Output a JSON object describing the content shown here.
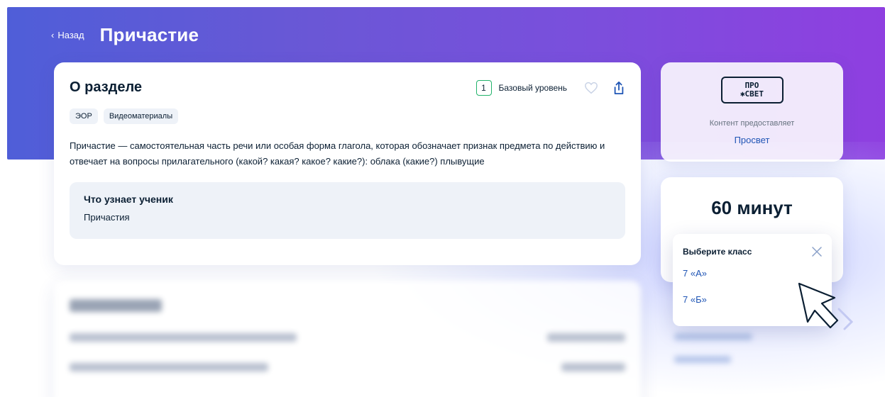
{
  "header": {
    "back_label": "Назад",
    "title": "Причастие"
  },
  "about": {
    "title": "О разделе",
    "level_number": "1",
    "level_label": "Базовый уровень",
    "tags": [
      "ЭОР",
      "Видеоматериалы"
    ],
    "description": "Причастие — самостоятельная часть речи или особая форма глагола, которая обозначает признак предмета по действию и отвечает на вопросы прилагательного (какой? какая? какое? какие?): облака (какие?) плывущие",
    "learn_title": "Что узнает ученик",
    "learn_text": "Причастия"
  },
  "provider": {
    "logo_top": "ПРО",
    "logo_bottom": "✱СВЕТ",
    "label": "Контент предоставляет",
    "name": "Просвет"
  },
  "duration": {
    "value": "60 минут"
  },
  "class_dropdown": {
    "title": "Выберите класс",
    "options": [
      "7 «А»",
      "7 «Б»"
    ]
  },
  "icons": {
    "back": "chevron-left-icon",
    "favorite": "heart-icon",
    "share": "share-icon",
    "close": "close-icon",
    "cursor": "hand-pointer-icon"
  },
  "colors": {
    "accent_link": "#1f55b5",
    "level_border": "#22b36b",
    "hero_start": "#4f5ed8",
    "hero_end": "#8f3fe0"
  }
}
